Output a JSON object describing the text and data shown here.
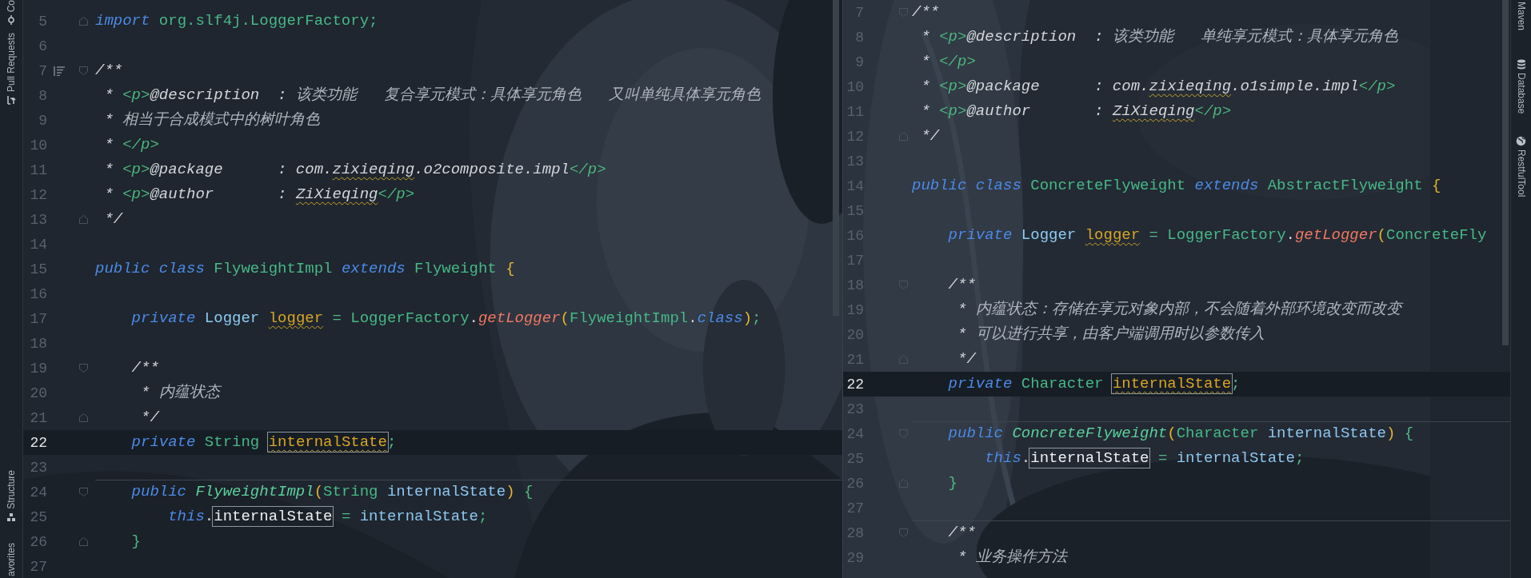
{
  "tool_strip_left": [
    {
      "label": "Co"
    },
    {
      "label": "Pull Requests"
    },
    {
      "label": "Structure"
    },
    {
      "label": "avorites"
    }
  ],
  "editors": [
    {
      "lines": [
        {
          "number": "5",
          "kind": "fold-end",
          "current": false,
          "separator": false,
          "tokens": [
            {
              "text": "import ",
              "kind": "kw"
            },
            {
              "text": "org.slf4j.LoggerFactory;",
              "kind": "type"
            }
          ]
        },
        {
          "number": "6",
          "kind": "plain",
          "current": false,
          "separator": false
        },
        {
          "number": "7",
          "kind": "fold-start-doc",
          "current": false,
          "separator": false,
          "tokens": [
            {
              "text": "/**",
              "kind": "doc"
            }
          ]
        },
        {
          "number": "8",
          "kind": "plain",
          "current": false,
          "separator": false,
          "tokens": [
            {
              "text": " * ",
              "kind": "doc"
            },
            {
              "text": "<p>",
              "kind": "doc-tag"
            },
            {
              "text": "@description  : ",
              "kind": "doc"
            },
            {
              "text": "该类功能   复合享元模式：具体享元角色   又叫单纯具体享元角色",
              "kind": "doc-text"
            }
          ]
        },
        {
          "number": "9",
          "kind": "plain",
          "current": false,
          "separator": false,
          "tokens": [
            {
              "text": " * ",
              "kind": "doc"
            },
            {
              "text": "相当于合成模式中的树叶角色",
              "kind": "doc-text"
            }
          ]
        },
        {
          "number": "10",
          "kind": "plain",
          "current": false,
          "separator": false,
          "tokens": [
            {
              "text": " * ",
              "kind": "doc"
            },
            {
              "text": "</p>",
              "kind": "doc-tag"
            }
          ]
        },
        {
          "number": "11",
          "kind": "plain",
          "current": false,
          "separator": false,
          "tokens": [
            {
              "text": " * ",
              "kind": "doc"
            },
            {
              "text": "<p>",
              "kind": "doc-tag"
            },
            {
              "text": "@package      : com.",
              "kind": "doc"
            },
            {
              "text": "zixieqing",
              "kind": "doc-warn"
            },
            {
              "text": ".o2composite.impl",
              "kind": "doc"
            },
            {
              "text": "</p>",
              "kind": "doc-tag"
            }
          ]
        },
        {
          "number": "12",
          "kind": "plain",
          "current": false,
          "separator": false,
          "tokens": [
            {
              "text": " * ",
              "kind": "doc"
            },
            {
              "text": "<p>",
              "kind": "doc-tag"
            },
            {
              "text": "@author       : ",
              "kind": "doc"
            },
            {
              "text": "ZiXieqing",
              "kind": "doc-warn"
            },
            {
              "text": "</p>",
              "kind": "doc-tag"
            }
          ]
        },
        {
          "number": "13",
          "kind": "fold-end",
          "current": false,
          "separator": false,
          "tokens": [
            {
              "text": " */",
              "kind": "doc"
            }
          ]
        },
        {
          "number": "14",
          "kind": "plain",
          "current": false,
          "separator": false
        },
        {
          "number": "15",
          "kind": "plain",
          "current": false,
          "separator": false,
          "tokens": [
            {
              "text": "public class ",
              "kind": "kw"
            },
            {
              "text": "FlyweightImpl ",
              "kind": "type"
            },
            {
              "text": "extends ",
              "kind": "kw"
            },
            {
              "text": "Flyweight ",
              "kind": "type"
            },
            {
              "text": "{",
              "kind": "brace"
            }
          ]
        },
        {
          "number": "16",
          "kind": "plain",
          "current": false,
          "separator": false
        },
        {
          "number": "17",
          "kind": "plain",
          "current": false,
          "separator": false,
          "tokens": [
            {
              "text": "    private ",
              "kind": "kw"
            },
            {
              "text": "Logger ",
              "kind": "cls"
            },
            {
              "text": "logger",
              "kind": "field-warn"
            },
            {
              "text": " = ",
              "kind": "op"
            },
            {
              "text": "LoggerFactory",
              "kind": "type"
            },
            {
              "text": ".",
              "kind": "punct"
            },
            {
              "text": "getLogger",
              "kind": "method"
            },
            {
              "text": "(",
              "kind": "brace"
            },
            {
              "text": "FlyweightImpl",
              "kind": "type"
            },
            {
              "text": ".",
              "kind": "punct"
            },
            {
              "text": "class",
              "kind": "kw"
            },
            {
              "text": ")",
              "kind": "brace"
            },
            {
              "text": ";",
              "kind": "op"
            }
          ]
        },
        {
          "number": "18",
          "kind": "plain",
          "current": false,
          "separator": false
        },
        {
          "number": "19",
          "kind": "fold-start",
          "current": false,
          "separator": false,
          "tokens": [
            {
              "text": "    /**",
              "kind": "doc"
            }
          ]
        },
        {
          "number": "20",
          "kind": "plain",
          "current": false,
          "separator": false,
          "tokens": [
            {
              "text": "     * ",
              "kind": "doc"
            },
            {
              "text": "内蕴状态",
              "kind": "doc-text"
            }
          ]
        },
        {
          "number": "21",
          "kind": "fold-end",
          "current": false,
          "separator": false,
          "tokens": [
            {
              "text": "     */",
              "kind": "doc"
            }
          ]
        },
        {
          "number": "22",
          "kind": "plain",
          "current": true,
          "separator": false,
          "tokens": [
            {
              "text": "    private ",
              "kind": "kw"
            },
            {
              "text": "String ",
              "kind": "type"
            },
            {
              "text": "internalState",
              "kind": "field-warn-boxed"
            },
            {
              "text": ";",
              "kind": "op"
            }
          ]
        },
        {
          "number": "23",
          "kind": "plain",
          "current": false,
          "separator": false
        },
        {
          "number": "24",
          "kind": "fold-start",
          "current": false,
          "separator": true,
          "tokens": [
            {
              "text": "    public ",
              "kind": "kw"
            },
            {
              "text": "FlyweightImpl",
              "kind": "method-decl"
            },
            {
              "text": "(",
              "kind": "brace"
            },
            {
              "text": "String ",
              "kind": "type"
            },
            {
              "text": "internalState",
              "kind": "var"
            },
            {
              "text": ") ",
              "kind": "brace"
            },
            {
              "text": "{",
              "kind": "op"
            }
          ]
        },
        {
          "number": "25",
          "kind": "plain",
          "current": false,
          "separator": false,
          "tokens": [
            {
              "text": "        this",
              "kind": "kw"
            },
            {
              "text": ".",
              "kind": "punct"
            },
            {
              "text": "internalState",
              "kind": "var-boxed"
            },
            {
              "text": " = ",
              "kind": "op"
            },
            {
              "text": "internalState",
              "kind": "var"
            },
            {
              "text": ";",
              "kind": "op"
            }
          ]
        },
        {
          "number": "26",
          "kind": "fold-end",
          "current": false,
          "separator": false,
          "tokens": [
            {
              "text": "    }",
              "kind": "op"
            }
          ]
        },
        {
          "number": "27",
          "kind": "plain",
          "current": false,
          "separator": false
        }
      ]
    },
    {
      "lines": [
        {
          "number": "7",
          "kind": "fold-start",
          "current": false,
          "separator": false,
          "tokens": [
            {
              "text": "/**",
              "kind": "doc"
            }
          ]
        },
        {
          "number": "8",
          "kind": "plain",
          "current": false,
          "separator": false,
          "tokens": [
            {
              "text": " * ",
              "kind": "doc"
            },
            {
              "text": "<p>",
              "kind": "doc-tag"
            },
            {
              "text": "@description  : ",
              "kind": "doc"
            },
            {
              "text": "该类功能   单纯享元模式：具体享元角色",
              "kind": "doc-text"
            }
          ]
        },
        {
          "number": "9",
          "kind": "plain",
          "current": false,
          "separator": false,
          "tokens": [
            {
              "text": " * ",
              "kind": "doc"
            },
            {
              "text": "</p>",
              "kind": "doc-tag"
            }
          ]
        },
        {
          "number": "10",
          "kind": "plain",
          "current": false,
          "separator": false,
          "tokens": [
            {
              "text": " * ",
              "kind": "doc"
            },
            {
              "text": "<p>",
              "kind": "doc-tag"
            },
            {
              "text": "@package      : com.",
              "kind": "doc"
            },
            {
              "text": "zixieqing",
              "kind": "doc-warn"
            },
            {
              "text": ".o1simple.impl",
              "kind": "doc"
            },
            {
              "text": "</p>",
              "kind": "doc-tag"
            }
          ]
        },
        {
          "number": "11",
          "kind": "plain",
          "current": false,
          "separator": false,
          "tokens": [
            {
              "text": " * ",
              "kind": "doc"
            },
            {
              "text": "<p>",
              "kind": "doc-tag"
            },
            {
              "text": "@author       : ",
              "kind": "doc"
            },
            {
              "text": "ZiXieqing",
              "kind": "doc-warn"
            },
            {
              "text": "</p>",
              "kind": "doc-tag"
            }
          ]
        },
        {
          "number": "12",
          "kind": "fold-end",
          "current": false,
          "separator": false,
          "tokens": [
            {
              "text": " */",
              "kind": "doc"
            }
          ]
        },
        {
          "number": "13",
          "kind": "plain",
          "current": false,
          "separator": false
        },
        {
          "number": "14",
          "kind": "plain",
          "current": false,
          "separator": false,
          "tokens": [
            {
              "text": "public class ",
              "kind": "kw"
            },
            {
              "text": "ConcreteFlyweight ",
              "kind": "type"
            },
            {
              "text": "extends ",
              "kind": "kw"
            },
            {
              "text": "AbstractFlyweight ",
              "kind": "type"
            },
            {
              "text": "{",
              "kind": "brace"
            }
          ]
        },
        {
          "number": "15",
          "kind": "plain",
          "current": false,
          "separator": false
        },
        {
          "number": "16",
          "kind": "plain",
          "current": false,
          "separator": false,
          "tokens": [
            {
              "text": "    private ",
              "kind": "kw"
            },
            {
              "text": "Logger ",
              "kind": "cls"
            },
            {
              "text": "logger",
              "kind": "field-warn"
            },
            {
              "text": " = ",
              "kind": "op"
            },
            {
              "text": "LoggerFactory",
              "kind": "type"
            },
            {
              "text": ".",
              "kind": "punct"
            },
            {
              "text": "getLogger",
              "kind": "method"
            },
            {
              "text": "(",
              "kind": "brace"
            },
            {
              "text": "ConcreteFly",
              "kind": "type"
            }
          ]
        },
        {
          "number": "17",
          "kind": "plain",
          "current": false,
          "separator": false
        },
        {
          "number": "18",
          "kind": "fold-start",
          "current": false,
          "separator": false,
          "tokens": [
            {
              "text": "    /**",
              "kind": "doc"
            }
          ]
        },
        {
          "number": "19",
          "kind": "plain",
          "current": false,
          "separator": false,
          "tokens": [
            {
              "text": "     * ",
              "kind": "doc"
            },
            {
              "text": "内蕴状态：存储在享元对象内部，不会随着外部环境改变而改变",
              "kind": "doc-text"
            }
          ]
        },
        {
          "number": "20",
          "kind": "plain",
          "current": false,
          "separator": false,
          "tokens": [
            {
              "text": "     * ",
              "kind": "doc"
            },
            {
              "text": "可以进行共享，由客户端调用时以参数传入",
              "kind": "doc-text"
            }
          ]
        },
        {
          "number": "21",
          "kind": "fold-end",
          "current": false,
          "separator": false,
          "tokens": [
            {
              "text": "     */",
              "kind": "doc"
            }
          ]
        },
        {
          "number": "22",
          "kind": "plain",
          "current": true,
          "separator": false,
          "tokens": [
            {
              "text": "    private ",
              "kind": "kw"
            },
            {
              "text": "Character ",
              "kind": "type"
            },
            {
              "text": "internalState",
              "kind": "field-warn-boxed"
            },
            {
              "text": ";",
              "kind": "op"
            }
          ]
        },
        {
          "number": "23",
          "kind": "plain",
          "current": false,
          "separator": false
        },
        {
          "number": "24",
          "kind": "fold-start",
          "current": false,
          "separator": true,
          "tokens": [
            {
              "text": "    public ",
              "kind": "kw"
            },
            {
              "text": "ConcreteFlyweight",
              "kind": "method-decl"
            },
            {
              "text": "(",
              "kind": "brace"
            },
            {
              "text": "Character ",
              "kind": "type"
            },
            {
              "text": "internalState",
              "kind": "var"
            },
            {
              "text": ") ",
              "kind": "brace"
            },
            {
              "text": "{",
              "kind": "op"
            }
          ]
        },
        {
          "number": "25",
          "kind": "plain",
          "current": false,
          "separator": false,
          "tokens": [
            {
              "text": "        this",
              "kind": "kw"
            },
            {
              "text": ".",
              "kind": "punct"
            },
            {
              "text": "internalState",
              "kind": "var-boxed"
            },
            {
              "text": " = ",
              "kind": "op"
            },
            {
              "text": "internalState",
              "kind": "var"
            },
            {
              "text": ";",
              "kind": "op"
            }
          ]
        },
        {
          "number": "26",
          "kind": "fold-end",
          "current": false,
          "separator": false,
          "tokens": [
            {
              "text": "    }",
              "kind": "op"
            }
          ]
        },
        {
          "number": "27",
          "kind": "plain",
          "current": false,
          "separator": false
        },
        {
          "number": "28",
          "kind": "fold-start",
          "current": false,
          "separator": true,
          "tokens": [
            {
              "text": "    /**",
              "kind": "doc"
            }
          ]
        },
        {
          "number": "29",
          "kind": "plain",
          "current": false,
          "separator": false,
          "tokens": [
            {
              "text": "     * ",
              "kind": "doc"
            },
            {
              "text": "业务操作方法",
              "kind": "doc-text"
            }
          ]
        }
      ]
    }
  ],
  "tool_strip_right": [
    {
      "label": "Maven"
    },
    {
      "label": "Database"
    },
    {
      "label": "RestfulTool"
    }
  ]
}
